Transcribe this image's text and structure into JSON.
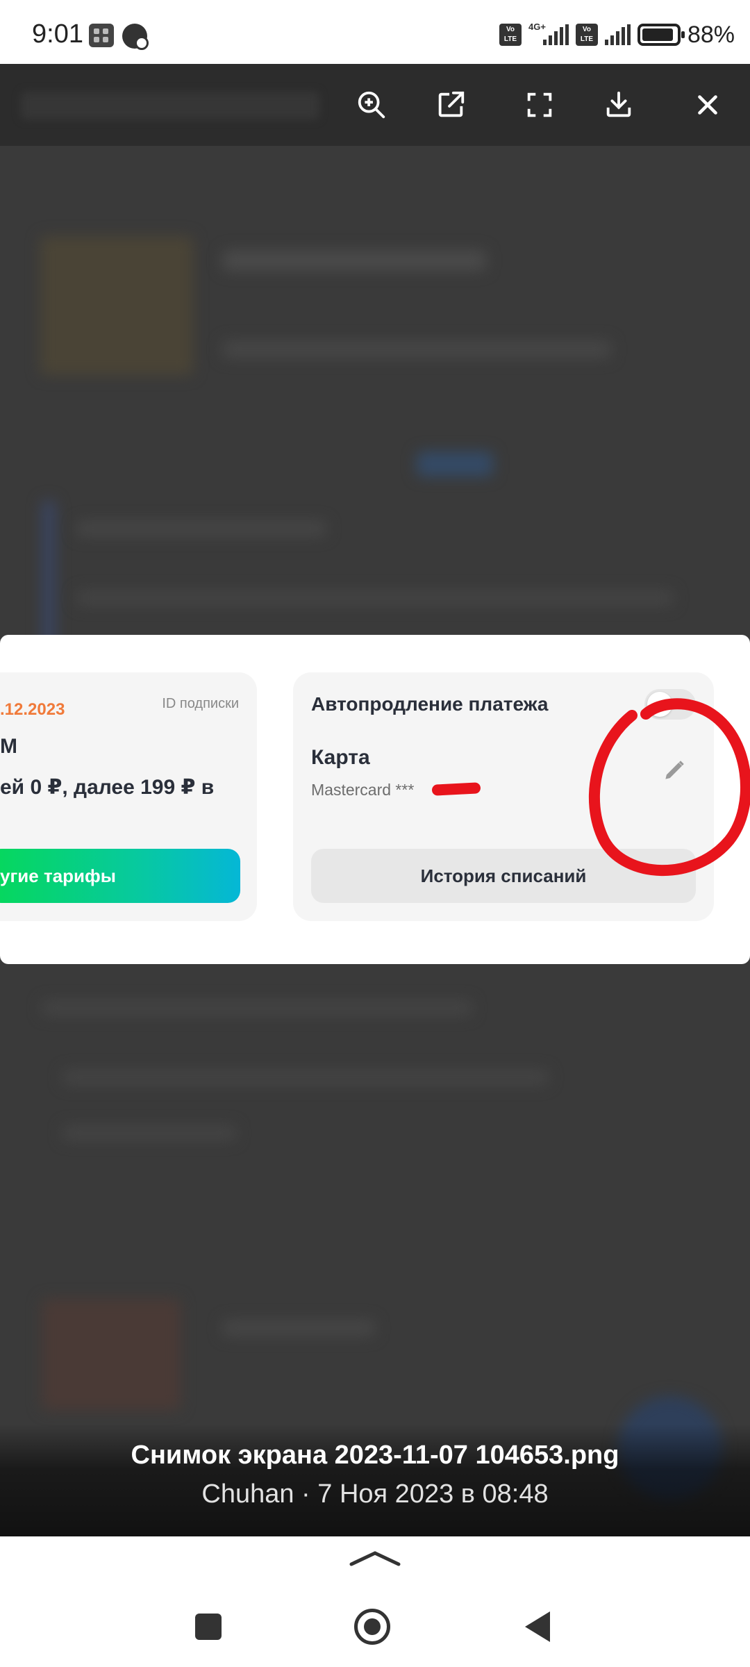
{
  "status_bar": {
    "time": "9:01",
    "network_label": "4G+",
    "volte_label": "Vo LTE",
    "battery_percent": "88%",
    "battery_level": 0.88
  },
  "toolbar": {
    "icons": [
      "zoom-in-icon",
      "open-external-icon",
      "fullscreen-icon",
      "download-icon",
      "close-icon"
    ]
  },
  "dialog": {
    "left_card": {
      "date": ".12.2023",
      "subscription_id_label": "ID подписки",
      "tariff_name": "М",
      "price_text": "ей 0 ₽, далее 199 ₽ в",
      "button_label": "угие тарифы"
    },
    "right_card": {
      "autopay_label": "Автопродление платежа",
      "autopay_enabled": false,
      "card_label": "Карта",
      "card_number": "Mastercard ***",
      "history_button_label": "История списаний"
    }
  },
  "caption": {
    "title": "Снимок экрана 2023-11-07 104653.png",
    "subtitle": "Chuhan · 7 Ноя 2023 в 08:48"
  },
  "colors": {
    "accent_orange": "#f07a3a",
    "gradient_start": "#06d85a",
    "gradient_end": "#05b7d6",
    "annotation_red": "#e8141c"
  }
}
